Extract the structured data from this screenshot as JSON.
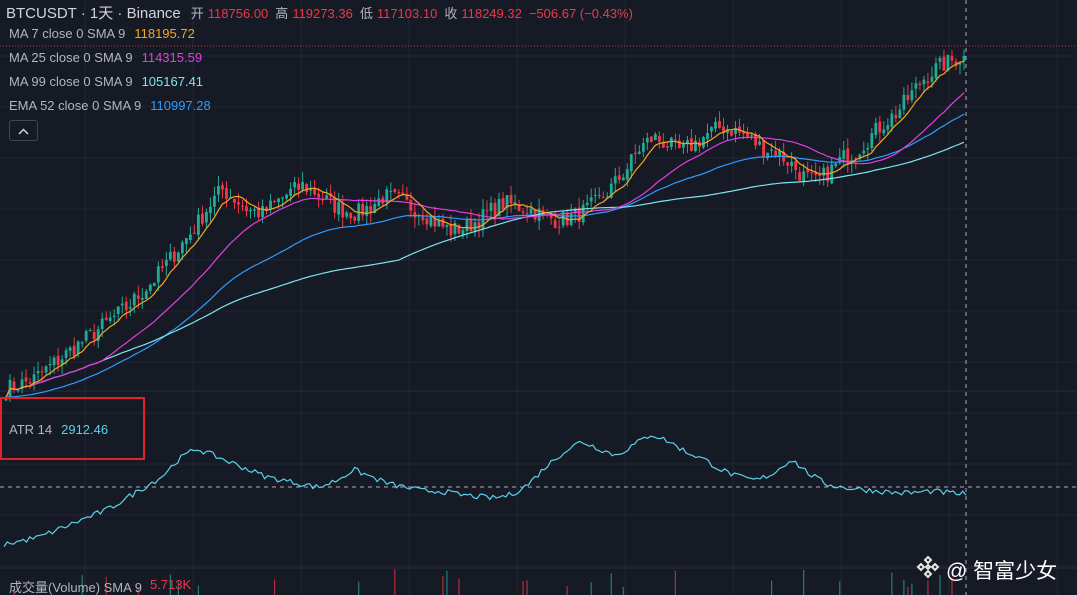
{
  "header": {
    "symbol": "BTCUSDT · 1天 · Binance",
    "open_label": "开",
    "open_value": "118756.00",
    "high_label": "高",
    "high_value": "119273.36",
    "low_label": "低",
    "low_value": "117103.10",
    "close_label": "收",
    "close_value": "118249.32",
    "change": "−506.67 (−0.43%)"
  },
  "indicators": [
    {
      "name": "MA 7 close 0 SMA 9",
      "value": "118195.72",
      "color": "#f5a623"
    },
    {
      "name": "MA 25 close 0 SMA 9",
      "value": "114315.59",
      "color": "#e040e0"
    },
    {
      "name": "MA 99 close 0 SMA 9",
      "value": "105167.41",
      "color": "#7fe3ef"
    },
    {
      "name": "EMA 52 close 0 SMA 9",
      "value": "110997.28",
      "color": "#2f9bff"
    }
  ],
  "collapse_icon": "chevron-up-icon",
  "atr": {
    "name": "ATR 14",
    "value": "2912.46",
    "color": "#5ad1e8"
  },
  "volume": {
    "name": "成交量(Volume) SMA 9",
    "value": "5.713K",
    "color": "#f23645"
  },
  "watermark": {
    "logo_icon": "binance-logo-icon",
    "text": "@ 智富少女"
  },
  "colors": {
    "up": "#22ab94",
    "down": "#f23645",
    "background": "#161a25",
    "grid": "#232733"
  },
  "chart_data": {
    "type": "candlestick",
    "interval": "1天",
    "exchange": "Binance",
    "last_open": 118756.0,
    "last_high": 119273.36,
    "last_low": 117103.1,
    "last_close": 118249.32,
    "price_range_approx": [
      70000,
      122000
    ],
    "closes_approx": [
      70200,
      70800,
      71500,
      73000,
      74500,
      76000,
      77500,
      79000,
      80500,
      82000,
      84000,
      86000,
      88500,
      91000,
      93500,
      96500,
      99000,
      97500,
      96000,
      95500,
      97000,
      98500,
      99500,
      98500,
      97000,
      96000,
      95500,
      96500,
      98000,
      97500,
      96500,
      95500,
      94000,
      93000,
      93500,
      94500,
      96000,
      97000,
      96500,
      96000,
      95000,
      94500,
      95000,
      96000,
      97500,
      99500,
      102000,
      105000,
      106500,
      105500,
      104500,
      105500,
      107000,
      108000,
      107500,
      106500,
      105000,
      104500,
      103000,
      101000,
      100000,
      101500,
      103500,
      104500,
      106500,
      108500,
      110000,
      112500,
      115000,
      116500,
      117500,
      118200
    ],
    "ma7": 118195.72,
    "ma25": 114315.59,
    "ma99": 105167.41,
    "ema52": 110997.28,
    "atr14_approx": [
      1500,
      1600,
      1700,
      1900,
      2100,
      2300,
      2500,
      2800,
      3100,
      3400,
      3900,
      4200,
      4000,
      3800,
      3600,
      3400,
      3300,
      3200,
      3100,
      3300,
      3600,
      3400,
      3200,
      3100,
      3000,
      3000,
      2900,
      2850,
      2800,
      2900,
      3200,
      3700,
      4100,
      4400,
      4200,
      4000,
      4300,
      4600,
      4400,
      4100,
      3900,
      3600,
      3400,
      3300,
      3500,
      3900,
      3500,
      3200,
      3100,
      3050,
      3000,
      2950,
      2950,
      3000,
      2950,
      2912.46
    ]
  }
}
